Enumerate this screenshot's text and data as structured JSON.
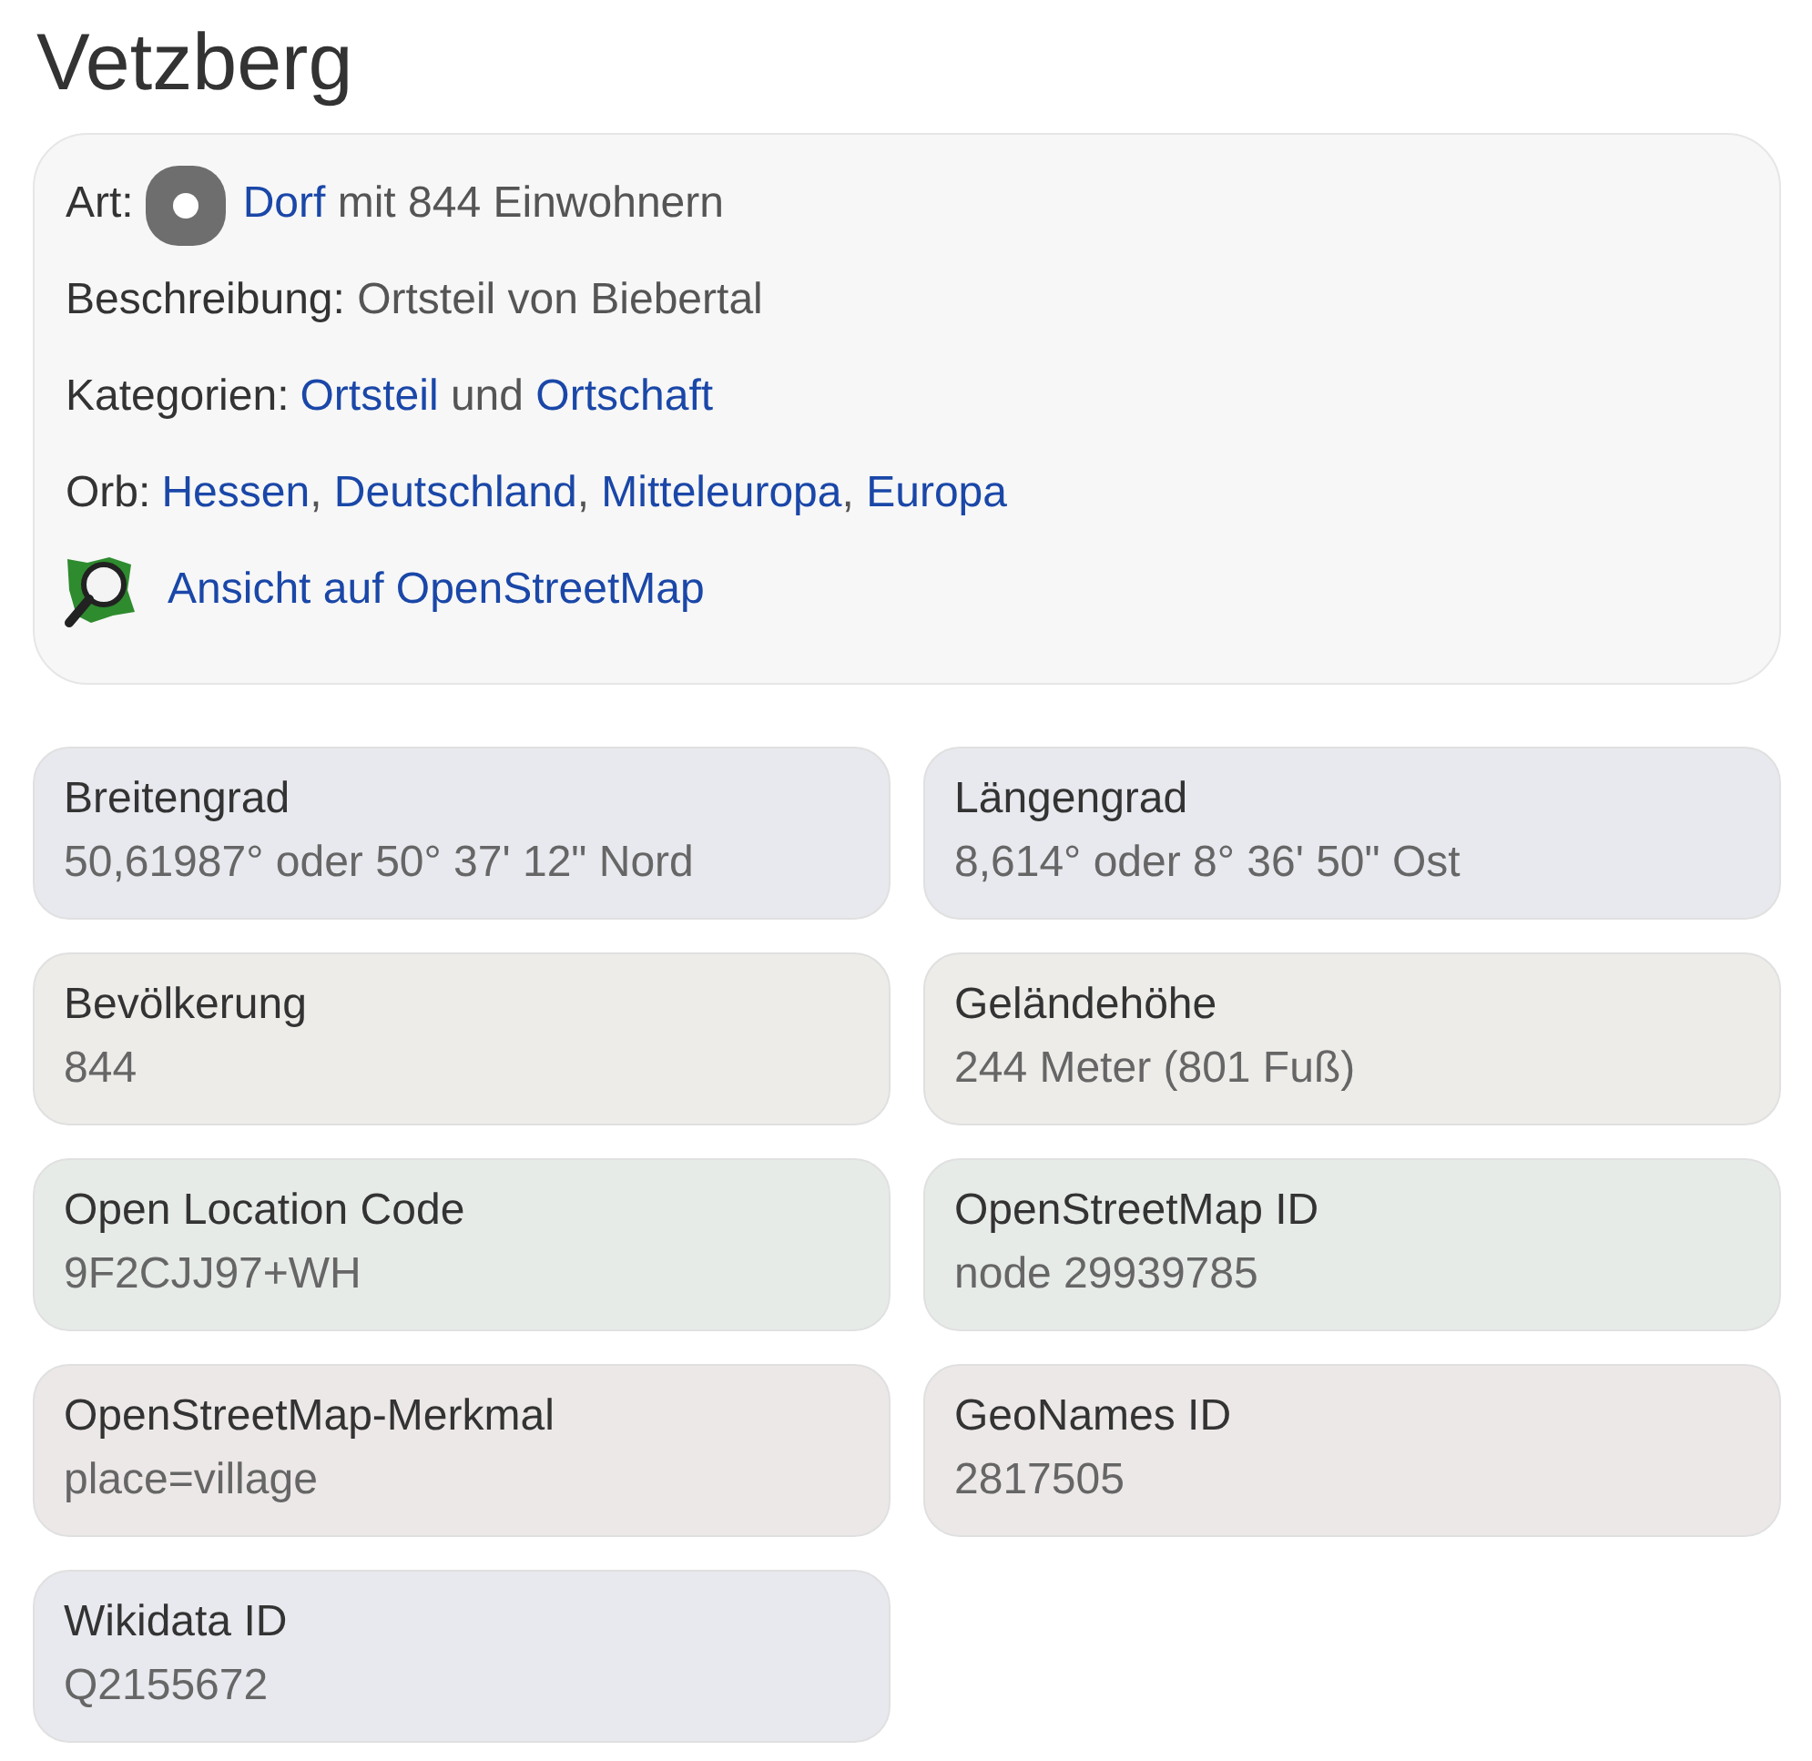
{
  "title": "Vetzberg",
  "info": [
    {
      "label": "Art:",
      "parts": [
        {
          "kind": "marker"
        },
        {
          "kind": "link",
          "text": "Dorf"
        },
        {
          "kind": "text",
          "text": " mit 844 Einwohnern"
        }
      ]
    },
    {
      "label": "Beschreibung:",
      "parts": [
        {
          "kind": "text",
          "text": " Ortsteil von Biebertal"
        }
      ]
    },
    {
      "label": "Kategorien:",
      "parts": [
        {
          "kind": "link",
          "text": "Ortsteil"
        },
        {
          "kind": "text",
          "text": " und "
        },
        {
          "kind": "link",
          "text": "Ortschaft"
        }
      ]
    },
    {
      "label": "Orb:",
      "parts": [
        {
          "kind": "link",
          "text": "Hessen"
        },
        {
          "kind": "text",
          "text": ", "
        },
        {
          "kind": "link",
          "text": "Deutschland"
        },
        {
          "kind": "text",
          "text": ", "
        },
        {
          "kind": "link",
          "text": "Mitteleuropa"
        },
        {
          "kind": "text",
          "text": ", "
        },
        {
          "kind": "link",
          "text": "Europa"
        }
      ]
    },
    {
      "parts": [
        {
          "kind": "map"
        },
        {
          "kind": "link",
          "text": "Ansicht auf OpenStreetMap"
        }
      ]
    }
  ],
  "facts": [
    {
      "label": "Breitengrad",
      "value": "50,61987° oder 50° 37' 12\" Nord",
      "color": "#e8e9ee"
    },
    {
      "label": "Längengrad",
      "value": "8,614° oder 8° 36' 50\" Ost",
      "color": "#e8e9ee"
    },
    {
      "label": "Bevölkerung",
      "value": "844",
      "color": "#edece9"
    },
    {
      "label": "Geländehöhe",
      "value": "244 Meter (801 Fuß)",
      "color": "#edece9"
    },
    {
      "label": "Open Location Code",
      "value": "9F2CJJ97+WH",
      "color": "#e7ebe8"
    },
    {
      "label": "OpenStreetMap ID",
      "value": "node 29939785",
      "color": "#e7ebe8"
    },
    {
      "label": "OpenStreetMap-Merkmal",
      "value": "place=village",
      "color": "#ede8e8"
    },
    {
      "label": "GeoNames ID",
      "value": "2817505",
      "color": "#ede8e8"
    },
    {
      "label": "Wikidata ID",
      "value": "Q2155672",
      "color": "#e8e9ee"
    }
  ]
}
